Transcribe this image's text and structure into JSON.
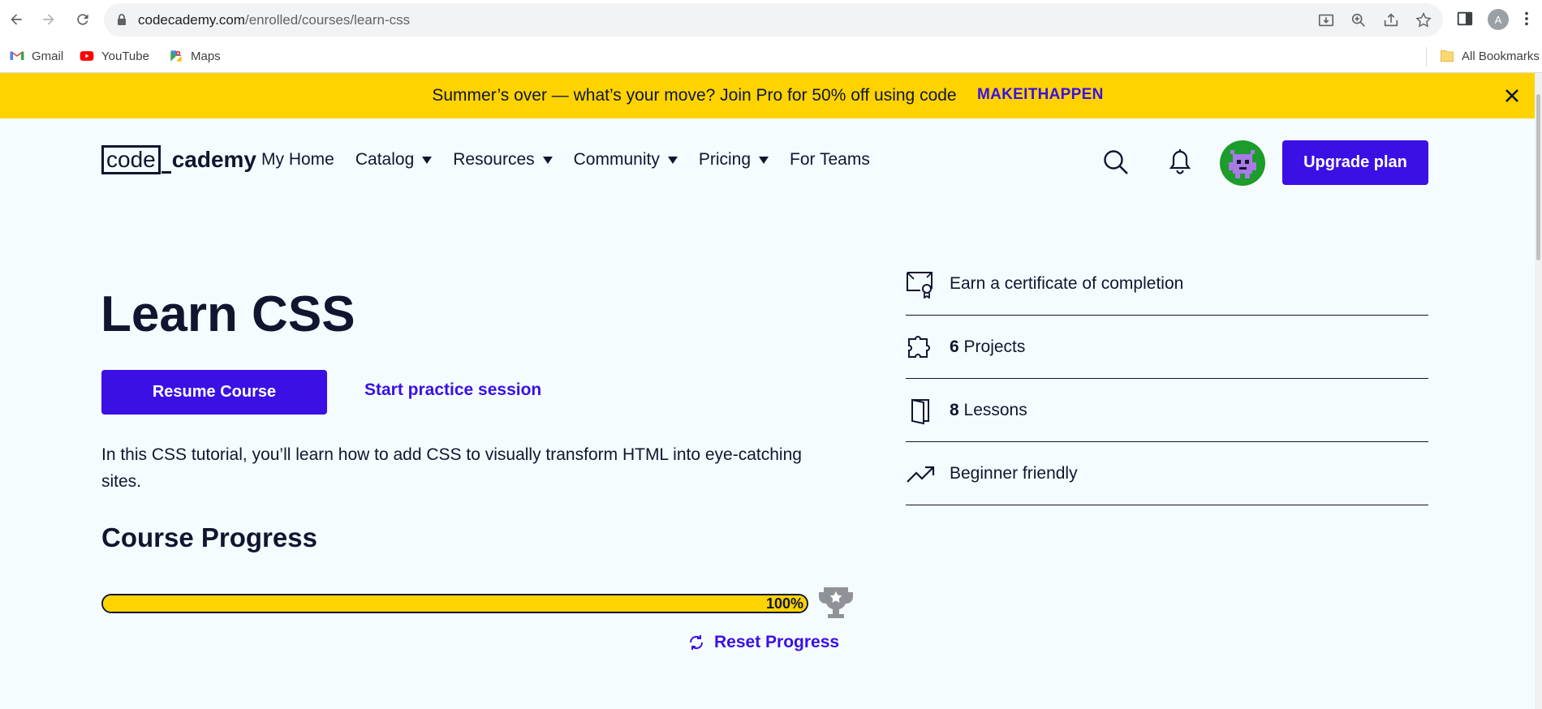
{
  "browser": {
    "url_host": "codecademy.com",
    "url_path": "/enrolled/courses/learn-css",
    "profile_initial": "A",
    "bookmarks": [
      {
        "label": "Gmail",
        "icon": "gmail-icon"
      },
      {
        "label": "YouTube",
        "icon": "youtube-icon"
      },
      {
        "label": "Maps",
        "icon": "maps-icon"
      }
    ],
    "all_bookmarks_label": "All Bookmarks"
  },
  "promo": {
    "text": "Summer’s over — what’s your move? Join Pro for 50% off using code",
    "code": "MAKEITHAPPEN",
    "background": "#ffd300"
  },
  "header": {
    "logo_code": "code",
    "logo_academy": "cademy",
    "nav": [
      {
        "label": "My Home",
        "dropdown": false
      },
      {
        "label": "Catalog",
        "dropdown": true
      },
      {
        "label": "Resources",
        "dropdown": true
      },
      {
        "label": "Community",
        "dropdown": true
      },
      {
        "label": "Pricing",
        "dropdown": true
      },
      {
        "label": "For Teams",
        "dropdown": false
      }
    ],
    "upgrade_label": "Upgrade plan"
  },
  "course": {
    "title": "Learn CSS",
    "resume_label": "Resume Course",
    "practice_label": "Start practice session",
    "description": "In this CSS tutorial, you’ll learn how to add CSS to visually transform HTML into eye-catching sites.",
    "progress_heading": "Course Progress",
    "progress_percent": 100,
    "progress_label": "100%",
    "reset_label": "Reset Progress"
  },
  "features": [
    {
      "icon": "certificate-icon",
      "count": "",
      "label": "Earn a certificate of completion"
    },
    {
      "icon": "puzzle-icon",
      "count": "6",
      "label": " Projects"
    },
    {
      "icon": "book-icon",
      "count": "8",
      "label": " Lessons"
    },
    {
      "icon": "trending-up-icon",
      "count": "",
      "label": "Beginner friendly"
    }
  ],
  "colors": {
    "brand_purple": "#3a10e5",
    "navy": "#10162f",
    "page_bg": "#f5fcff"
  }
}
